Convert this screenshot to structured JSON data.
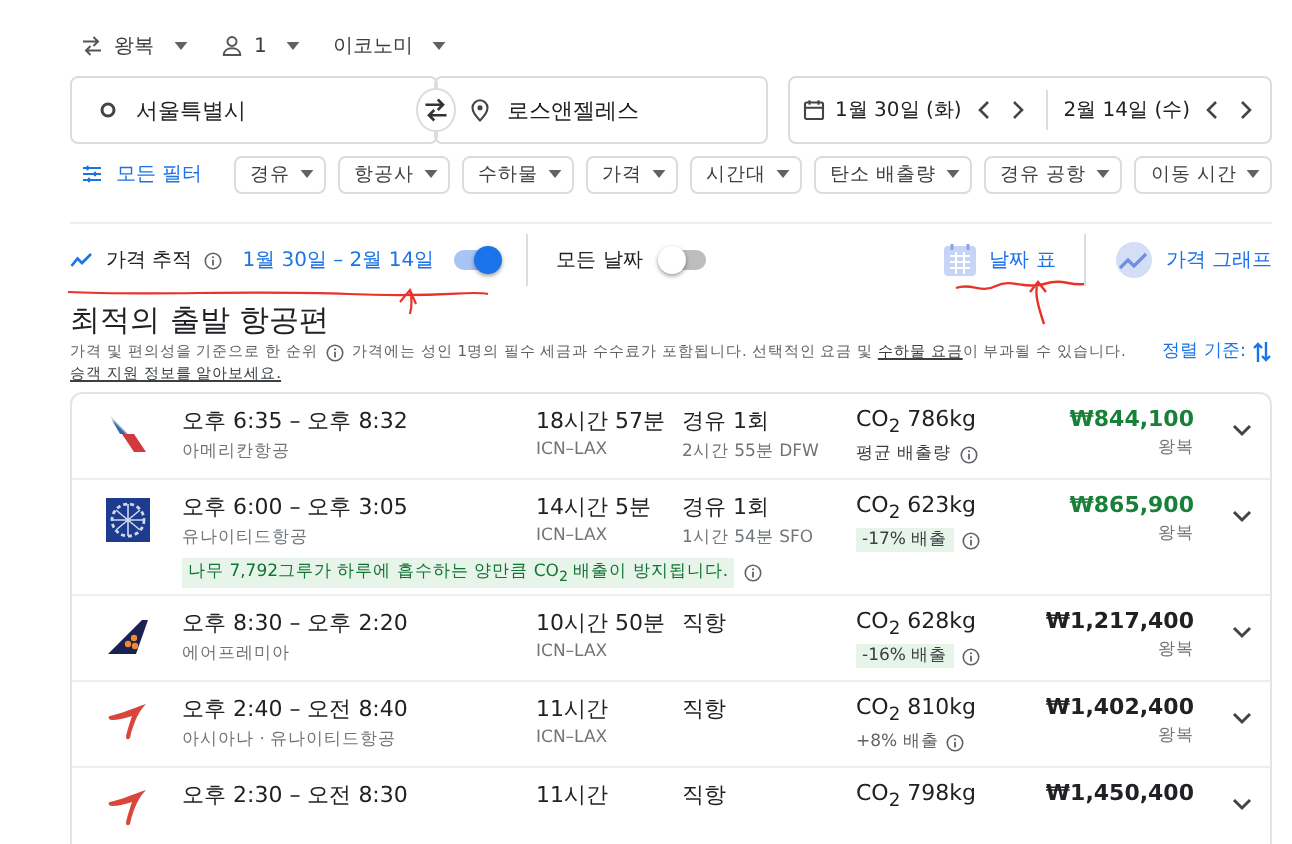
{
  "trip_options": [
    {
      "kind": "trip",
      "label": "왕복"
    },
    {
      "kind": "passengers",
      "label": "1"
    },
    {
      "kind": "class",
      "label": "이코노미"
    }
  ],
  "search": {
    "origin": "서울특별시",
    "destination": "로스앤젤레스",
    "depart": "1월 30일 (화)",
    "return": "2월 14일 (수)"
  },
  "all_filters": "모든 필터",
  "filters": [
    "경유",
    "항공사",
    "수하물",
    "가격",
    "시간대",
    "탄소 배출량",
    "경유 공항",
    "이동 시간"
  ],
  "tracking": {
    "label": "가격 추적",
    "dates": "1월 30일 – 2월 14일",
    "on": true
  },
  "all_dates": {
    "label": "모든 날짜",
    "on": false
  },
  "views": [
    {
      "kind": "date-grid",
      "label": "날짜 표"
    },
    {
      "kind": "price-graph",
      "label": "가격 그래프"
    }
  ],
  "section_title": "최적의 출발 항공편",
  "ranking_note": "가격 및 편의성을 기준으로 한 순위",
  "price_note_parts": [
    "가격에는 성인 1명의 필수 세금과 수수료가 포함됩니다. 선택적인 요금 및 ",
    "수하물 요금",
    "이 부과될 수 있습니다."
  ],
  "assist_link": "승객 지원 정보를 알아보세요.",
  "sort_label": "정렬 기준:",
  "flights": [
    {
      "kind": "tail-stripes",
      "times": "오후 6:35 – 오후 8:32",
      "airline": "아메리칸항공",
      "duration": "18시간 57분",
      "route": "ICN–LAX",
      "stops": "경유 1회",
      "layover": "2시간 55분 DFW",
      "co2": "CO$_{2}$ 786kg",
      "emission": {
        "kind": "average",
        "text": "평균 배출량"
      },
      "price": "₩844,100",
      "cheap": true,
      "fare": "왕복"
    },
    {
      "kind": "globe",
      "times": "오후 6:00 – 오후 3:05",
      "airline": "유나이티드항공",
      "duration": "14시간 5분",
      "route": "ICN–LAX",
      "stops": "경유 1회",
      "layover": "1시간 54분 SFO",
      "co2": "CO$_{2}$ 623kg",
      "emission": {
        "kind": "lower",
        "text": "-17% 배출"
      },
      "price": "₩865,900",
      "cheap": true,
      "fare": "왕복",
      "banner": "나무 7,792그루가 하루에 흡수하는 양만큼 CO$_{2}$ 배출이 방지됩니다."
    },
    {
      "kind": "tail-dots",
      "times": "오후 8:30 – 오후 2:20",
      "airline": "에어프레미아",
      "duration": "10시간 50분",
      "route": "ICN–LAX",
      "stops": "직항",
      "co2": "CO$_{2}$ 628kg",
      "emission": {
        "kind": "lower",
        "text": "-16% 배출"
      },
      "price": "₩1,217,400",
      "cheap": false,
      "fare": "왕복"
    },
    {
      "kind": "swoosh",
      "times": "오후 2:40 – 오전 8:40",
      "airline": "아시아나 · 유나이티드항공",
      "duration": "11시간",
      "route": "ICN–LAX",
      "stops": "직항",
      "co2": "CO$_{2}$ 810kg",
      "emission": {
        "kind": "higher",
        "text": "+8% 배출"
      },
      "price": "₩1,402,400",
      "cheap": false,
      "fare": "왕복"
    },
    {
      "kind": "swoosh",
      "times": "오후 2:30 – 오전 8:30",
      "duration": "11시간",
      "stops": "직항",
      "co2": "CO$_{2}$ 798kg",
      "price": "₩1,450,400",
      "cheap": false
    }
  ]
}
